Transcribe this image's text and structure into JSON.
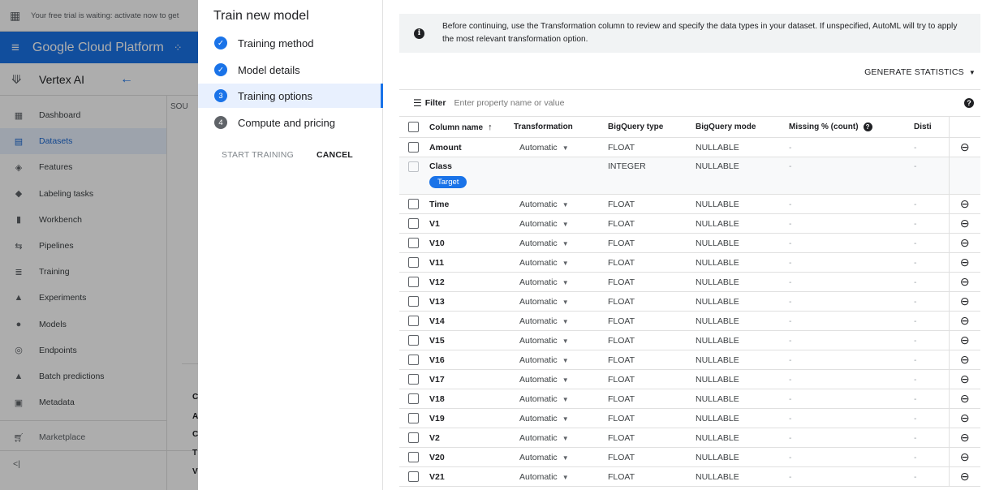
{
  "background": {
    "trial_text": "Your free trial is waiting: activate now to get",
    "platform_title": "Google Cloud Platform",
    "product_name": "Vertex AI",
    "source_fragment": "SOU",
    "nav_items": [
      {
        "label": "Dashboard",
        "icon": "dashboard-icon",
        "glyph": "▦"
      },
      {
        "label": "Datasets",
        "icon": "datasets-icon",
        "glyph": "▤"
      },
      {
        "label": "Features",
        "icon": "features-icon",
        "glyph": "◈"
      },
      {
        "label": "Labeling tasks",
        "icon": "labeling-icon",
        "glyph": "◆"
      },
      {
        "label": "Workbench",
        "icon": "workbench-icon",
        "glyph": "▮"
      },
      {
        "label": "Pipelines",
        "icon": "pipelines-icon",
        "glyph": "⇆"
      },
      {
        "label": "Training",
        "icon": "training-icon",
        "glyph": "≣"
      },
      {
        "label": "Experiments",
        "icon": "experiments-icon",
        "glyph": "▲"
      },
      {
        "label": "Models",
        "icon": "models-icon",
        "glyph": "●"
      },
      {
        "label": "Endpoints",
        "icon": "endpoints-icon",
        "glyph": "◎"
      },
      {
        "label": "Batch predictions",
        "icon": "batch-predictions-icon",
        "glyph": "▲"
      },
      {
        "label": "Metadata",
        "icon": "metadata-icon",
        "glyph": "▣"
      }
    ],
    "active_nav": "Datasets",
    "marketplace_label": "Marketplace",
    "collapse_label": "<|",
    "row_fragments": [
      "C",
      "A",
      "C",
      "T",
      "V"
    ]
  },
  "stepper": {
    "title": "Train new model",
    "steps": [
      {
        "label": "Training method",
        "status": "done",
        "marker": "✓"
      },
      {
        "label": "Model details",
        "status": "done",
        "marker": "✓"
      },
      {
        "label": "Training options",
        "status": "active",
        "marker": "3"
      },
      {
        "label": "Compute and pricing",
        "status": "todo",
        "marker": "4"
      }
    ],
    "start_label": "START TRAINING",
    "cancel_label": "CANCEL"
  },
  "main": {
    "info_text": "Before continuing, use the Transformation column to review and specify the data types in your dataset. If unspecified, AutoML will try to apply the most relevant transformation option.",
    "generate_label": "GENERATE STATISTICS",
    "filter_label": "Filter",
    "filter_placeholder": "Enter property name or value",
    "columns": {
      "name": "Column name",
      "transformation": "Transformation",
      "bq_type": "BigQuery type",
      "bq_mode": "BigQuery mode",
      "missing": "Missing % (count)",
      "distinct": "Disti"
    },
    "rows": [
      {
        "name": "Amount",
        "transformation": "Automatic",
        "bq_type": "FLOAT",
        "bq_mode": "NULLABLE",
        "missing": "-",
        "distinct": "-"
      },
      {
        "name": "Class",
        "transformation": "",
        "bq_type": "INTEGER",
        "bq_mode": "NULLABLE",
        "missing": "-",
        "distinct": "-",
        "badge": "Target"
      },
      {
        "name": "Time",
        "transformation": "Automatic",
        "bq_type": "FLOAT",
        "bq_mode": "NULLABLE",
        "missing": "-",
        "distinct": "-"
      },
      {
        "name": "V1",
        "transformation": "Automatic",
        "bq_type": "FLOAT",
        "bq_mode": "NULLABLE",
        "missing": "-",
        "distinct": "-"
      },
      {
        "name": "V10",
        "transformation": "Automatic",
        "bq_type": "FLOAT",
        "bq_mode": "NULLABLE",
        "missing": "-",
        "distinct": "-"
      },
      {
        "name": "V11",
        "transformation": "Automatic",
        "bq_type": "FLOAT",
        "bq_mode": "NULLABLE",
        "missing": "-",
        "distinct": "-"
      },
      {
        "name": "V12",
        "transformation": "Automatic",
        "bq_type": "FLOAT",
        "bq_mode": "NULLABLE",
        "missing": "-",
        "distinct": "-"
      },
      {
        "name": "V13",
        "transformation": "Automatic",
        "bq_type": "FLOAT",
        "bq_mode": "NULLABLE",
        "missing": "-",
        "distinct": "-"
      },
      {
        "name": "V14",
        "transformation": "Automatic",
        "bq_type": "FLOAT",
        "bq_mode": "NULLABLE",
        "missing": "-",
        "distinct": "-"
      },
      {
        "name": "V15",
        "transformation": "Automatic",
        "bq_type": "FLOAT",
        "bq_mode": "NULLABLE",
        "missing": "-",
        "distinct": "-"
      },
      {
        "name": "V16",
        "transformation": "Automatic",
        "bq_type": "FLOAT",
        "bq_mode": "NULLABLE",
        "missing": "-",
        "distinct": "-"
      },
      {
        "name": "V17",
        "transformation": "Automatic",
        "bq_type": "FLOAT",
        "bq_mode": "NULLABLE",
        "missing": "-",
        "distinct": "-"
      },
      {
        "name": "V18",
        "transformation": "Automatic",
        "bq_type": "FLOAT",
        "bq_mode": "NULLABLE",
        "missing": "-",
        "distinct": "-"
      },
      {
        "name": "V19",
        "transformation": "Automatic",
        "bq_type": "FLOAT",
        "bq_mode": "NULLABLE",
        "missing": "-",
        "distinct": "-"
      },
      {
        "name": "V2",
        "transformation": "Automatic",
        "bq_type": "FLOAT",
        "bq_mode": "NULLABLE",
        "missing": "-",
        "distinct": "-"
      },
      {
        "name": "V20",
        "transformation": "Automatic",
        "bq_type": "FLOAT",
        "bq_mode": "NULLABLE",
        "missing": "-",
        "distinct": "-"
      },
      {
        "name": "V21",
        "transformation": "Automatic",
        "bq_type": "FLOAT",
        "bq_mode": "NULLABLE",
        "missing": "-",
        "distinct": "-"
      }
    ]
  },
  "colors": {
    "accent": "#1a73e8",
    "active_bg": "#e8f0fe",
    "info_bg": "#f1f3f4",
    "scrim": "#000000"
  }
}
